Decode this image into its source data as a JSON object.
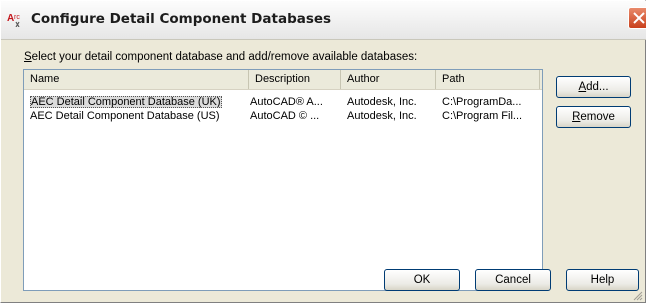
{
  "window": {
    "title": "Configure Detail Component Databases",
    "app_icon": "autocad-architecture-icon",
    "close_icon": "close-icon"
  },
  "prompt": {
    "accel": "S",
    "rest": "elect your detail component database and add/remove available databases:"
  },
  "list": {
    "columns": [
      "Name",
      "Description",
      "Author",
      "Path"
    ],
    "rows": [
      [
        "AEC Detail Component Database (UK)",
        "AutoCAD® A...",
        "Autodesk, Inc.",
        "C:\\ProgramDa..."
      ],
      [
        "AEC Detail Component Database (US)",
        "AutoCAD © ...",
        "Autodesk, Inc.",
        "C:\\Program Fil..."
      ]
    ],
    "selected_row": 0
  },
  "buttons": {
    "add_accel": "A",
    "add_rest": "dd...",
    "remove_accel": "R",
    "remove_rest": "emove",
    "ok": "OK",
    "cancel": "Cancel",
    "help": "Help"
  }
}
